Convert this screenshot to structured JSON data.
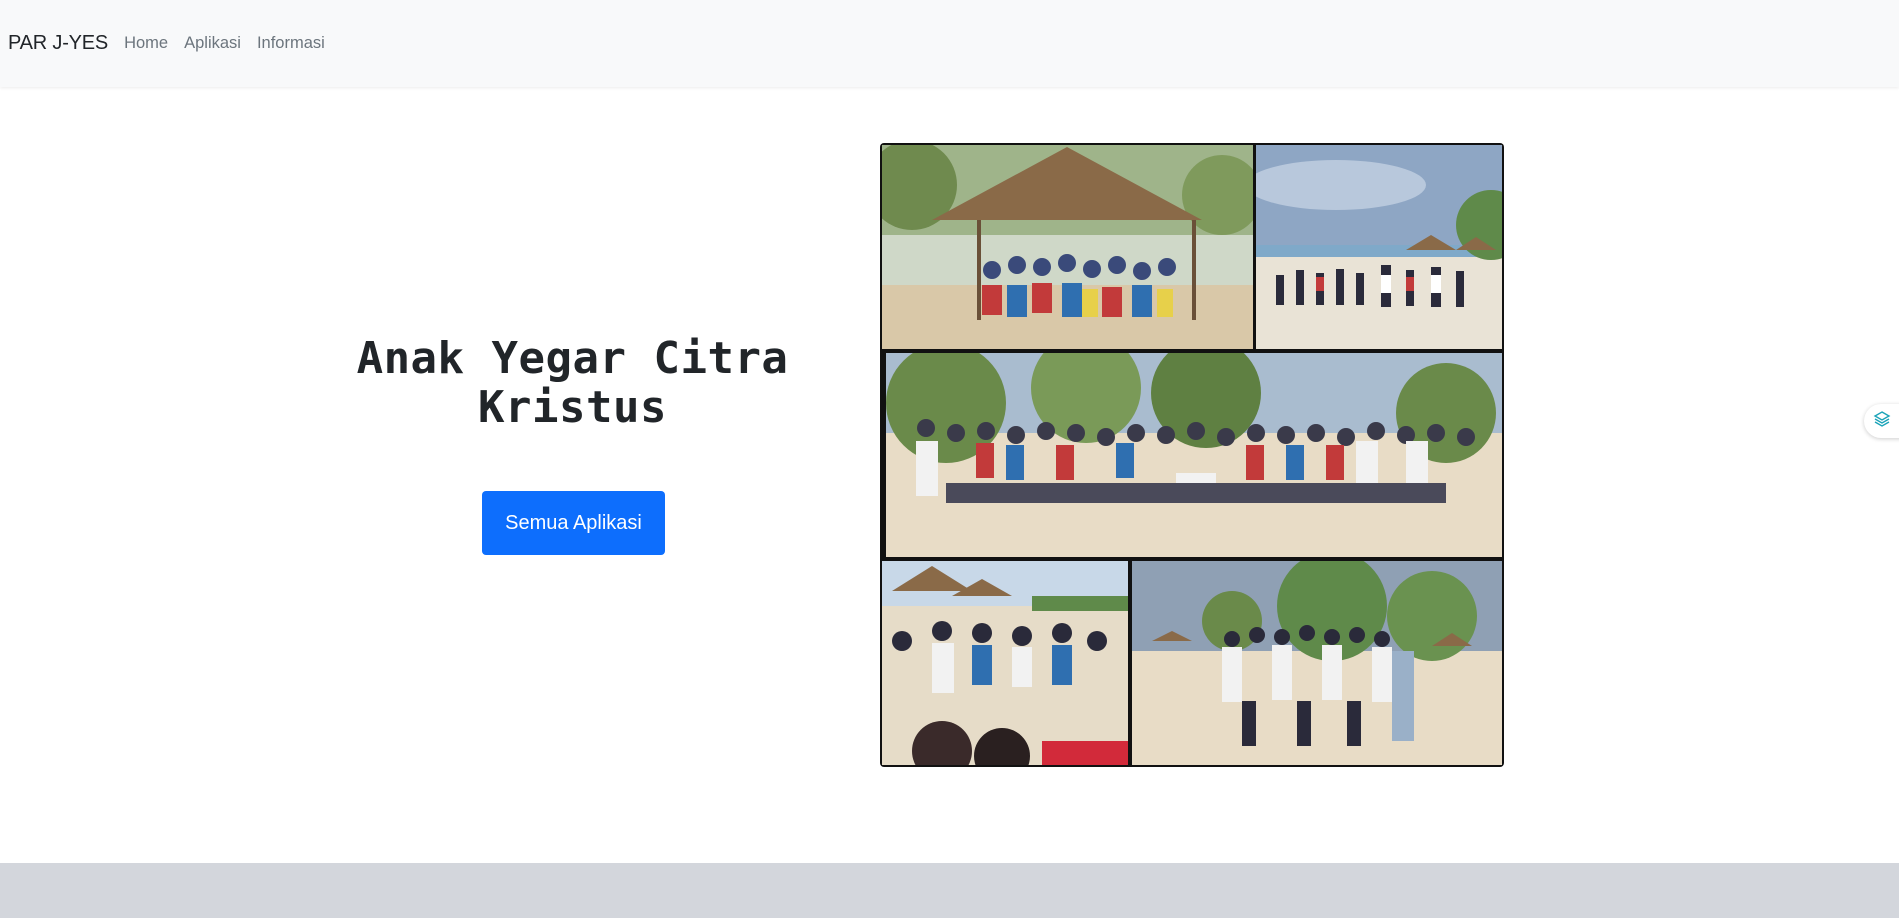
{
  "navbar": {
    "brand": "PAR J-YES",
    "links": [
      {
        "label": "Home"
      },
      {
        "label": "Aplikasi"
      },
      {
        "label": "Informasi"
      }
    ]
  },
  "hero": {
    "title_line1": "Anak Yegar Citra",
    "title_line2": "Kristus",
    "button_label": "Semua Aplikasi"
  },
  "collage": {
    "photos": [
      {
        "name": "group-under-hut-photo"
      },
      {
        "name": "beach-group-wide-photo"
      },
      {
        "name": "large-group-beach-photo"
      },
      {
        "name": "beach-crowd-closeup-photo"
      },
      {
        "name": "youth-group-beach-photo"
      }
    ]
  },
  "colors": {
    "navbar_bg": "#f8f9fa",
    "primary": "#0d6efd",
    "footer_band": "#d3d6dc",
    "text": "#212529",
    "nav_link": "#6c757d"
  }
}
